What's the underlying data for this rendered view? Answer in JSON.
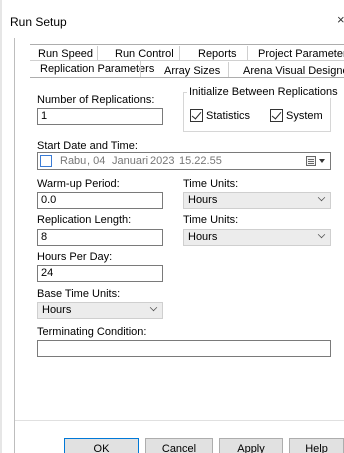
{
  "window": {
    "title": "Run Setup",
    "close_glyph": "×"
  },
  "tabs": {
    "row1": [
      "Run Speed",
      "Run Control",
      "Reports",
      "Project Parameters"
    ],
    "row2": [
      "Replication Parameters",
      "Array Sizes",
      "Arena Visual Designer"
    ],
    "active": "Replication Parameters"
  },
  "form": {
    "num_replications_label": "Number of Replications:",
    "num_replications_value": "1",
    "init_group_title": "Initialize Between Replications",
    "statistics_label": "Statistics",
    "statistics_checked": true,
    "system_label": "System",
    "system_checked": true,
    "start_date_label": "Start Date and Time:",
    "start_date": {
      "day_name": "Rabu",
      "day": ", 04",
      "month": "Januari",
      "year": "2023",
      "time": "15.22.55",
      "checked": false
    },
    "warmup_label": "Warm-up Period:",
    "warmup_value": "0.0",
    "warmup_units_label": "Time Units:",
    "warmup_units_value": "Hours",
    "replication_length_label": "Replication Length:",
    "replication_length_value": "8",
    "replication_units_label": "Time Units:",
    "replication_units_value": "Hours",
    "hours_per_day_label": "Hours Per Day:",
    "hours_per_day_value": "24",
    "base_time_units_label": "Base Time Units:",
    "base_time_units_value": "Hours",
    "terminating_label": "Terminating Condition:",
    "terminating_value": ""
  },
  "buttons": {
    "ok": "OK",
    "cancel": "Cancel",
    "apply": "Apply",
    "help": "Help"
  },
  "colors": {
    "accent": "#0078d7",
    "button_bg": "#e1e1e1",
    "select_bg": "#ececec"
  }
}
